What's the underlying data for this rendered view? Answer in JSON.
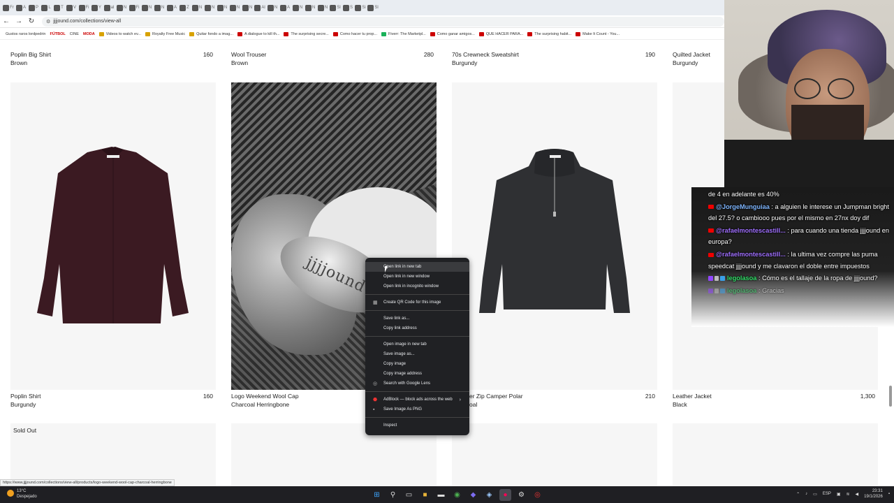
{
  "browser": {
    "tabs": [
      "Fr",
      "A",
      "P",
      "L",
      "T",
      "V",
      "Fi",
      "Y",
      "al",
      "N",
      "Fi",
      "N",
      "N",
      "A",
      "Z",
      "N",
      "N",
      "N",
      "N",
      "N",
      "Al",
      "N",
      "A",
      "N",
      "N",
      "N",
      "Sl",
      "S",
      "Si",
      "Sl"
    ],
    "url": "jjjjound.com/collections/view-all",
    "bookmarks": [
      {
        "label": "Gustos raros lordpedrin",
        "style": "plain"
      },
      {
        "label": "FÚTBOL",
        "style": "red"
      },
      {
        "label": "CINE",
        "style": "plain"
      },
      {
        "label": "MODA",
        "style": "red"
      },
      {
        "label": "Videos to watch ev...",
        "style": "folder"
      },
      {
        "label": "Royalty Free Music",
        "style": "folder"
      },
      {
        "label": "Quitar fondo a imag...",
        "style": "folder"
      },
      {
        "label": "A dialogue to kill th...",
        "style": "yt"
      },
      {
        "label": "The surprising secre...",
        "style": "yt"
      },
      {
        "label": "Como hacer tu prop...",
        "style": "yt"
      },
      {
        "label": "Fiverr: The Marketpl...",
        "style": "green"
      },
      {
        "label": "Como ganar amigos...",
        "style": "yt"
      },
      {
        "label": "QUE HACER PARA...",
        "style": "yt"
      },
      {
        "label": "The surprising habit...",
        "style": "yt"
      },
      {
        "label": "Make It Count - You...",
        "style": "yt"
      }
    ],
    "status_url": "https://www.jjjjound.com/collections/view-all/products/logo-weekend-wool-cap-charcoal-herringbone"
  },
  "products_top": [
    {
      "name": "Poplin Big Shirt",
      "color": "Brown",
      "price": "160"
    },
    {
      "name": "Wool Trouser",
      "color": "Brown",
      "price": "280"
    },
    {
      "name": "70s Crewneck Sweatshirt",
      "color": "Burgundy",
      "price": "190"
    },
    {
      "name": "Quilted Jacket",
      "color": "Burgundy",
      "price": ""
    }
  ],
  "products_mid": [
    {
      "name": "Poplin Shirt",
      "color": "Burgundy",
      "price": "160"
    },
    {
      "name": "Logo Weekend Wool Cap",
      "color": "Charcoal Herringbone",
      "price": ""
    },
    {
      "name": "er Zip Camper Polar",
      "color": "oal",
      "price": "210"
    },
    {
      "name": "Leather Jacket",
      "color": "Black",
      "price": "1,300"
    }
  ],
  "sold_out": "Sold Out",
  "cap_logo": "jjjjound",
  "context_menu": {
    "items": [
      {
        "label": "Open link in new tab",
        "highlight": true
      },
      {
        "label": "Open link in new window"
      },
      {
        "label": "Open link in incognito window"
      },
      {
        "sep": true
      },
      {
        "label": "Create QR Code for this image",
        "icon": "qr-icon"
      },
      {
        "sep": true
      },
      {
        "label": "Save link as..."
      },
      {
        "label": "Copy link address"
      },
      {
        "sep": true
      },
      {
        "label": "Open image in new tab"
      },
      {
        "label": "Save image as..."
      },
      {
        "label": "Copy image"
      },
      {
        "label": "Copy image address"
      },
      {
        "label": "Search with Google Lens",
        "icon": "lens-icon"
      },
      {
        "sep": true
      },
      {
        "label": "AdBlock — block ads across the web",
        "icon": "adblock-icon",
        "submenu": true
      },
      {
        "label": "Save Image As PNG",
        "icon": "png-icon"
      },
      {
        "sep": true
      },
      {
        "label": "Inspect"
      }
    ]
  },
  "chat": [
    {
      "platform": "",
      "user": "",
      "text": "de 4 en adelante es 40%"
    },
    {
      "platform": "yt",
      "user": "@JorgeMunguiaa",
      "user_color": "blue",
      "text": "a alguien le interese un Jumpman bright del 27.5? o cambiooo pues por el mismo en 27nx doy dif"
    },
    {
      "platform": "yt",
      "user": "@rafaelmontescastill...",
      "user_color": "purple",
      "text": "para cuando una tienda jjjjound en europa?"
    },
    {
      "platform": "yt",
      "user": "@rafaelmontescastill...",
      "user_color": "purple",
      "text": "la ultima vez compre las puma speedcat jjjjound y me clavaron el doble entre impuestos"
    },
    {
      "platform": "tw",
      "user": "legolasoa",
      "user_color": "green",
      "text": "Cómo es el tallaje de la ropa de jjjjound?"
    },
    {
      "platform": "tw",
      "user": "legolasoa",
      "user_color": "green",
      "text": "Gracias",
      "faded": true
    }
  ],
  "taskbar": {
    "weather_temp": "13°C",
    "weather_desc": "Despejado",
    "lang": "ESP",
    "time": "23:31",
    "date": "19/1/2026"
  }
}
